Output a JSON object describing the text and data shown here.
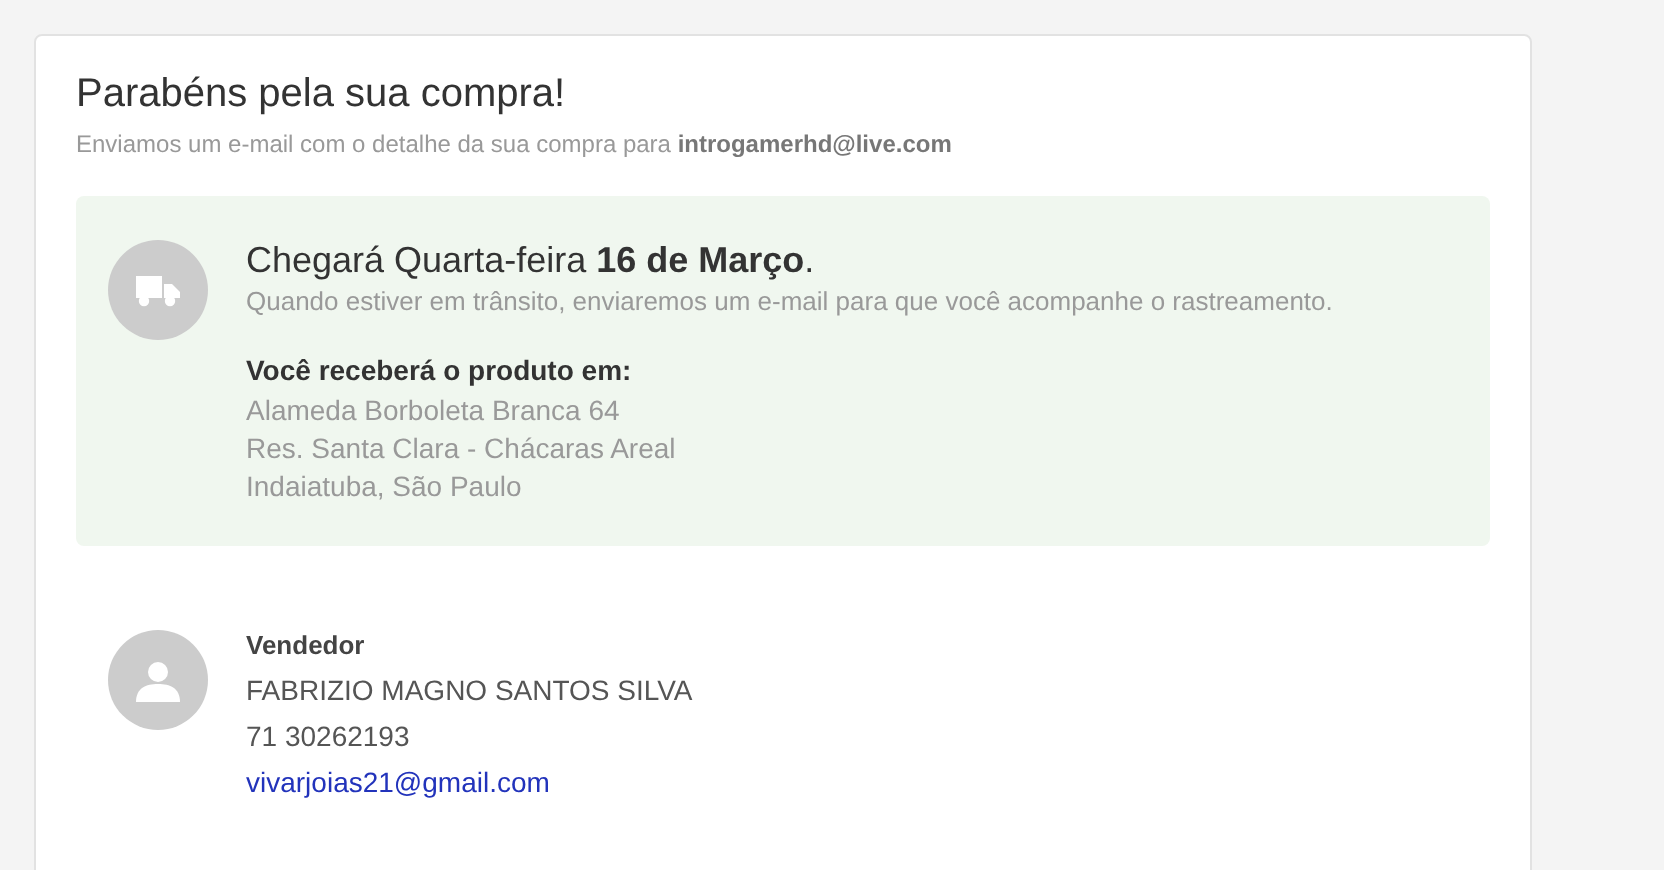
{
  "title": "Parabéns pela sua compra!",
  "subtitle": "Enviamos um e-mail com o detalhe da sua compra para **introgamerhd@live.com**",
  "delivery": {
    "heading": "Chegará Quarta-feira **16 de Março**.",
    "note": "Quando estiver em trânsito, enviaremos um e-mail para que você acompanhe o rastreamento.",
    "address_label": "Você receberá o produto em:",
    "address_lines": [
      "Alameda Borboleta Branca 64",
      "Res. Santa Clara - Chácaras Areal",
      "Indaiatuba, São Paulo"
    ]
  },
  "seller": {
    "label": "Vendedor",
    "name": "FABRIZIO MAGNO SANTOS SILVA",
    "phone": "71 30262193",
    "email": "vivarjoias21@gmail.com"
  }
}
